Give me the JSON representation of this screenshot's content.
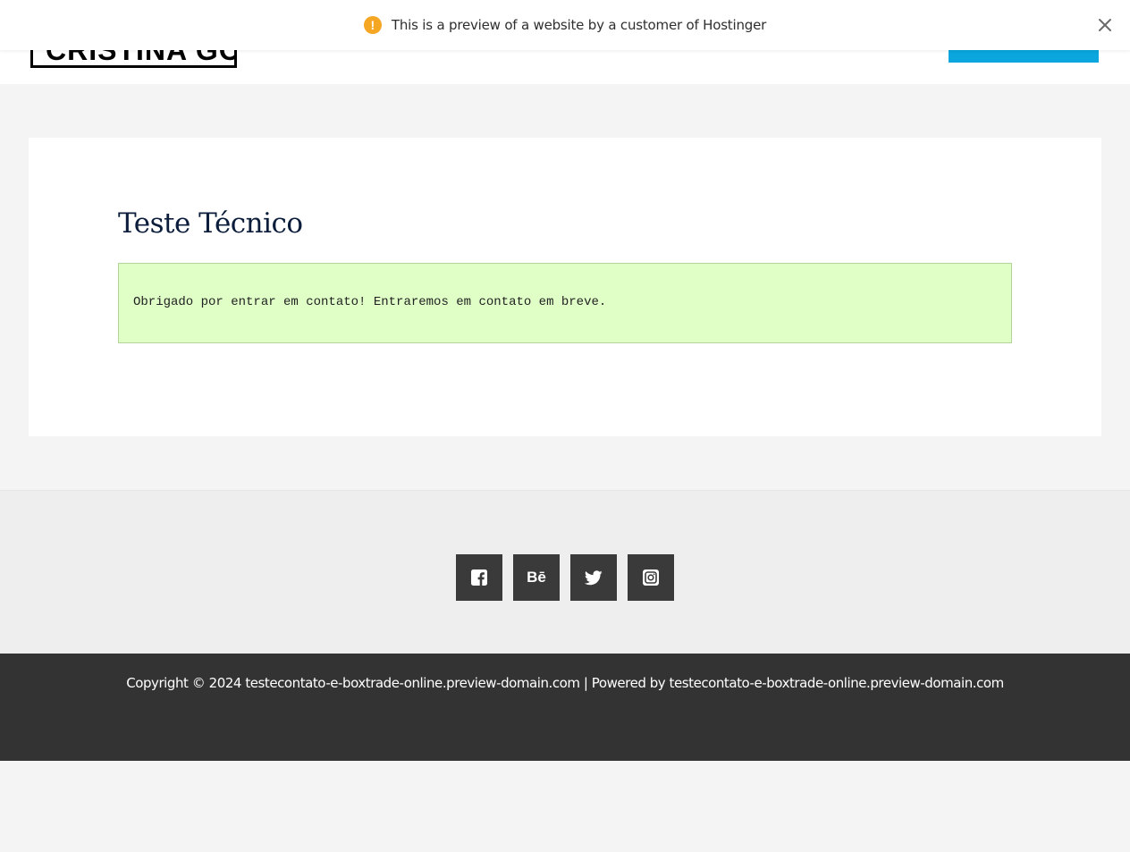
{
  "preview_banner": {
    "message": "This is a preview of a website by a customer of Hostinger",
    "warning_icon": "warning-circle-icon",
    "warning_glyph": "!",
    "close_icon": "close-icon",
    "accent_color": "#f5a623"
  },
  "header": {
    "logo_text": "CRISTINA GOMES",
    "cta_color": "#0aa6dd"
  },
  "main": {
    "title": "Teste Técnico",
    "success_message": "Obrigado por entrar em contato! Entraremos em contato em breve.",
    "success_bg_color": "#e0ffc7"
  },
  "social": {
    "links": [
      {
        "name": "facebook",
        "icon": "facebook-icon"
      },
      {
        "name": "behance",
        "icon": "behance-icon",
        "glyph": "Bē"
      },
      {
        "name": "twitter",
        "icon": "twitter-icon"
      },
      {
        "name": "instagram",
        "icon": "instagram-icon"
      }
    ],
    "button_color": "#3a3a3a"
  },
  "footer": {
    "copyright": "Copyright © 2024 testecontato-e-boxtrade-online.preview-domain.com | Powered by testecontato-e-boxtrade-online.preview-domain.com",
    "bg_color": "#333333"
  }
}
